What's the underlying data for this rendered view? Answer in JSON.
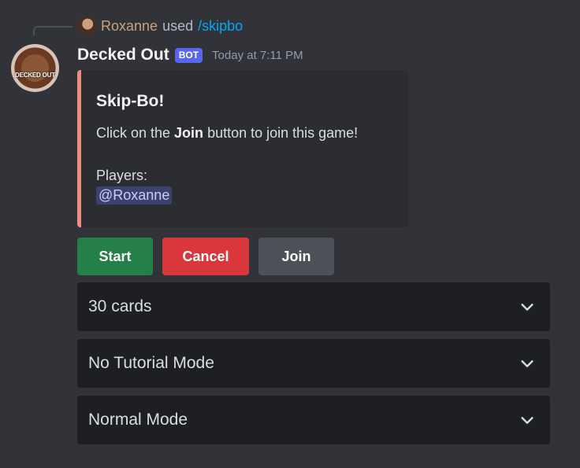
{
  "reply": {
    "user": "Roxanne",
    "used": "used",
    "command": "/skipbo"
  },
  "message": {
    "author": "Decked Out",
    "badge": "BOT",
    "timestamp": "Today at 7:11 PM",
    "avatar_text": "DECKED OUT"
  },
  "embed": {
    "accent_color": "#f38b82",
    "title": "Skip-Bo!",
    "desc_prefix": "Click on the ",
    "desc_bold": "Join",
    "desc_suffix": " button to join this game!",
    "players_label": "Players:",
    "players": [
      "@Roxanne"
    ]
  },
  "buttons": {
    "start": "Start",
    "cancel": "Cancel",
    "join": "Join"
  },
  "selects": [
    {
      "value": "30 cards",
      "icon": "chevron-down-icon"
    },
    {
      "value": "No Tutorial Mode",
      "icon": "chevron-down-icon"
    },
    {
      "value": "Normal Mode",
      "icon": "chevron-down-icon"
    }
  ],
  "colors": {
    "start": "#248046",
    "cancel": "#da373c",
    "join": "#4e5058",
    "bot_badge": "#5865f2",
    "command": "#00a8fc",
    "reply_user": "#c9a17c"
  }
}
